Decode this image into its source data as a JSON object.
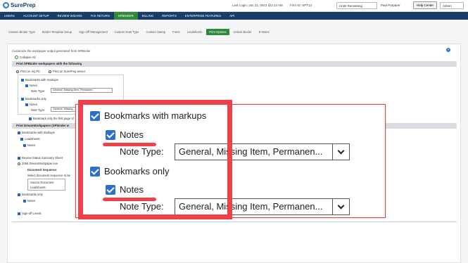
{
  "header": {
    "logo": "SurePrep",
    "last_login": "Last Login: Jan 21, 2023 @2:12 AM",
    "firm_id": "Firm ID: SPT13",
    "units": "Units Remaining",
    "user": "Paul Preparer",
    "help": "Help Center",
    "role": "Admin"
  },
  "mainnav": [
    "USERS",
    "ACCOUNT SETUP",
    "REVIEW WIZARD",
    "TAX RETURN",
    "SPBINDER",
    "BILLING",
    "REPORTS",
    "ENTERPRISE FEATURES",
    "API"
  ],
  "subtabs": [
    "Custom Binder Type",
    "Binder Template Setup",
    "Sign Off Management",
    "Custom Note Type",
    "Custom Stamp",
    "Fonts",
    "Leadsheets",
    "Print Options",
    "Unlock Binder",
    "E-Notes"
  ],
  "content": {
    "intro": "Customize the workpaper output generated from SPBinder",
    "collapse": "Collapse All",
    "section1": "Print SPBinder workpapers with the following",
    "print_pc": "Print on my PC",
    "print_server": "Print on SurePrep server",
    "section2": "Print DreamWorkpapers (SPbinder w",
    "bg_items": [
      "Bookmarks with markups",
      "Leadsheets",
      "Notes",
      "Review Status Summary Sheet",
      "2055 DreamWorkpaper.exe",
      "Document Sequence",
      "Select document sequence to be",
      "Source Document",
      "Leadsheets",
      "Bookmarks only",
      "Notes",
      "Sign-off Levels"
    ],
    "bg_bookmark_first": "Bookmark only the first page of"
  },
  "smallpop": {
    "bookmarks_markups": "Bookmarks with markups",
    "notes1": "Notes",
    "note_type_label": "Note Type:",
    "note_type_value1": "General, Missing Item, Permanen",
    "bookmarks_only": "Bookmarks only",
    "notes2": "Notes",
    "note_type_value2": "General, Missing"
  },
  "zoom": {
    "bookmarks_markups": "Bookmarks with markups",
    "notes1": "Notes",
    "note_type_label1": "Note Type:",
    "note_type_value1": "General, Missing Item, Permanen...",
    "bookmarks_only": "Bookmarks only",
    "notes2": "Notes",
    "note_type_label2": "Note Type:",
    "note_type_value2": "General, Missing Item, Permanen..."
  },
  "colors": {
    "nav": "#173d68",
    "active": "#2e8a3a",
    "highlight": "#f0414a",
    "checkbox": "#2d6fcf"
  }
}
